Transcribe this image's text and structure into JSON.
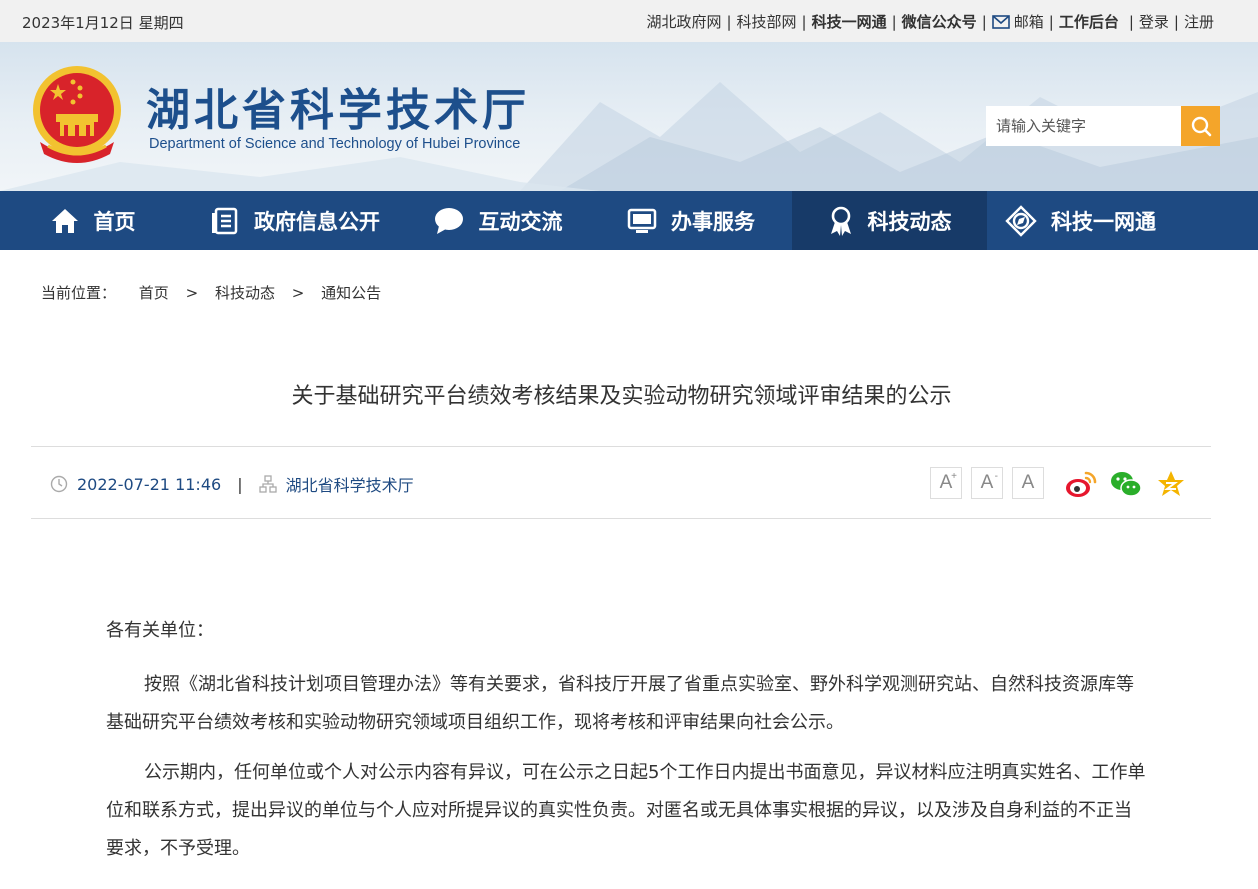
{
  "topbar": {
    "date": "2023年1月12日 星期四",
    "links": [
      "湖北政府网",
      "科技部网",
      "科技一网通",
      "微信公众号",
      "邮箱",
      "工作后台",
      "登录",
      "注册"
    ]
  },
  "header": {
    "title": "湖北省科学技术厅",
    "subtitle": "Department of Science and Technology of Hubei Province",
    "search_placeholder": "请输入关键字"
  },
  "nav": {
    "items": [
      "首页",
      "政府信息公开",
      "互动交流",
      "办事服务",
      "科技动态",
      "科技一网通"
    ],
    "active": "科技动态"
  },
  "breadcrumb": {
    "label": "当前位置：",
    "items": [
      "首页",
      "科技动态",
      "通知公告"
    ],
    "separator": ">"
  },
  "article": {
    "title": "关于基础研究平台绩效考核结果及实验动物研究领域评审结果的公示",
    "date": "2022-07-21 11:46",
    "source": "湖北省科学技术厅",
    "font_buttons": [
      "A",
      "A",
      "A"
    ],
    "salutation": "各有关单位：",
    "paragraphs": [
      "按照《湖北省科技计划项目管理办法》等有关要求，省科技厅开展了省重点实验室、野外科学观测研究站、自然科技资源库等基础研究平台绩效考核和实验动物研究领域项目组织工作，现将考核和评审结果向社会公示。",
      "公示期内，任何单位或个人对公示内容有异议，可在公示之日起5个工作日内提出书面意见，异议材料应注明真实姓名、工作单位和联系方式，提出异议的单位与个人应对所提异议的真实性负责。对匿名或无具体事实根据的异议，以及涉及自身利益的不正当要求，不予受理。"
    ]
  },
  "colors": {
    "nav_bg": "#1e4a82",
    "nav_active": "#173a68",
    "search_button": "#f4a52a",
    "title_blue": "#1d4f8c"
  }
}
